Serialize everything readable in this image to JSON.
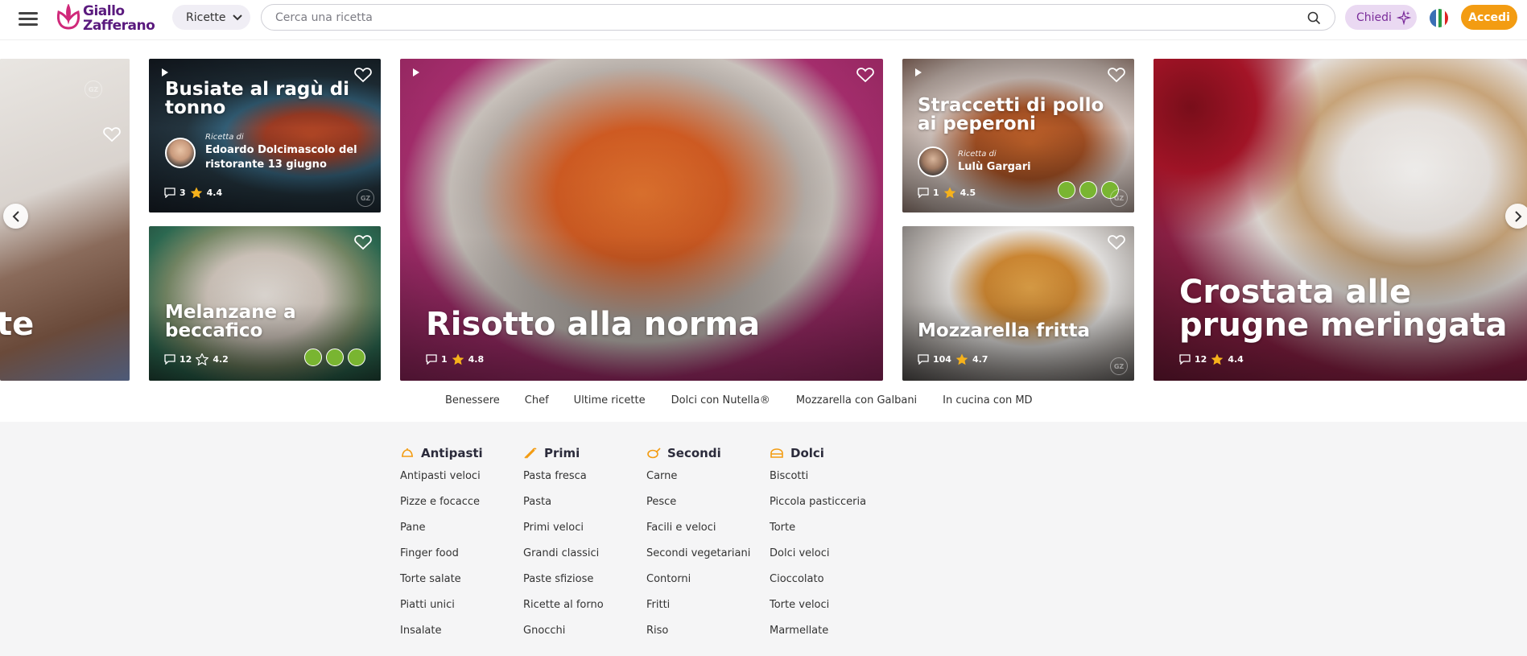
{
  "header": {
    "logo_line1": "Giallo",
    "logo_line2": "Zafferano",
    "ricette_label": "Ricette",
    "search_placeholder": "Cerca una ricetta",
    "chiedi_label": "Chiedi",
    "accedi_label": "Accedi"
  },
  "carousel": {
    "left_partial_title": "te",
    "busiate": {
      "title": "Busiate al ragù di tonno",
      "author_prefix": "Ricetta di",
      "author_name": "Edoardo Dolcimascolo del ristorante 13 giugno",
      "comments": "3",
      "rating": "4.4"
    },
    "melanzane": {
      "title": "Melanzane a beccafico",
      "comments": "12",
      "rating": "4.2"
    },
    "risotto": {
      "title": "Risotto alla norma",
      "comments": "1",
      "rating": "4.8"
    },
    "straccetti": {
      "title": "Straccetti di pollo ai peperoni",
      "author_prefix": "Ricetta di",
      "author_name": "Lulù Gargari",
      "comments": "1",
      "rating": "4.5"
    },
    "mozzarella": {
      "title": "Mozzarella fritta",
      "comments": "104",
      "rating": "4.7"
    },
    "crostata": {
      "title": "Crostata alle prugne meringata",
      "comments": "12",
      "rating": "4.4"
    }
  },
  "tags": [
    "Benessere",
    "Chef",
    "Ultime ricette",
    "Dolci con Nutella®",
    "Mozzarella con Galbani",
    "In cucina con MD"
  ],
  "menu": {
    "antipasti": {
      "title": "Antipasti",
      "items": [
        "Antipasti veloci",
        "Pizze e focacce",
        "Pane",
        "Finger food",
        "Torte salate",
        "Piatti unici",
        "Insalate"
      ]
    },
    "primi": {
      "title": "Primi",
      "items": [
        "Pasta fresca",
        "Pasta",
        "Primi veloci",
        "Grandi classici",
        "Paste sfiziose",
        "Ricette al forno",
        "Gnocchi"
      ]
    },
    "secondi": {
      "title": "Secondi",
      "items": [
        "Carne",
        "Pesce",
        "Facili e veloci",
        "Secondi vegetariani",
        "Contorni",
        "Fritti",
        "Riso"
      ]
    },
    "dolci": {
      "title": "Dolci",
      "items": [
        "Biscotti",
        "Piccola pasticceria",
        "Torte",
        "Dolci veloci",
        "Cioccolato",
        "Torte veloci",
        "Marmellate"
      ]
    }
  },
  "colors": {
    "brand_purple": "#5a1a7e",
    "accent_orange": "#f39c12",
    "badge_green": "#79b531",
    "star_yellow": "#f6b21b"
  }
}
